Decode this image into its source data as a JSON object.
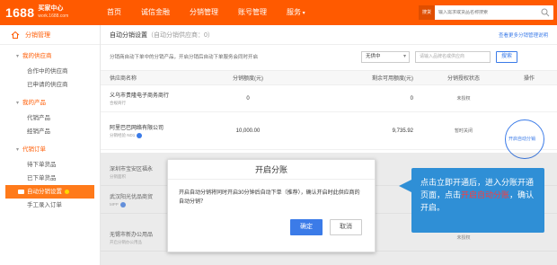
{
  "topbar": {
    "logo_num": "1688",
    "logo_title": "买家中心",
    "logo_url": "work.1688.com",
    "nav": [
      "首页",
      "诚信金融",
      "分销管理",
      "账号管理",
      "服务"
    ],
    "search_type": "搜货",
    "search_placeholder": "输入需求或货品名称搜索",
    "brand_color": "#ff5a00"
  },
  "sidebar": {
    "head": "分销管理",
    "groups": [
      {
        "title": "我的供应商",
        "items": [
          "合作中的供应商",
          "已申请的供应商"
        ]
      },
      {
        "title": "我的产品",
        "items": [
          "代销产品",
          "经销产品"
        ]
      },
      {
        "title": "代销订单",
        "items": [
          "待下单货品",
          "已下单货品",
          "自动分销设置",
          "手工录入订单"
        ]
      }
    ],
    "active_item": "自动分销设置"
  },
  "main": {
    "title": "自动分销设置",
    "title_count": "（自动分销供应商：0）",
    "help_link": "查看更多分销管理说明",
    "desc": "分销商自动下单中的分销产品，开启分销后自动下单服务会同时开启",
    "select_value": "无供中",
    "filter_placeholder": "请输入品牌名或供应商",
    "search_btn": "搜索",
    "columns": [
      "供应商名称",
      "分销额度(元)",
      "剩余可用额度(元)",
      "分销授权状态",
      "操作"
    ],
    "rows": [
      {
        "name": "义乌市贵隆电子商务商行",
        "tag": "合规商行",
        "quota": "0",
        "remain": "0",
        "status": "未授权",
        "action": ""
      },
      {
        "name": "阿里巴巴网络有限公司",
        "tag": "分销经验 ND1",
        "quota": "10,000.00",
        "remain": "9,735.92",
        "status": "暂时关闭",
        "action": "开启自动分销"
      },
      {
        "name": "深圳市宝安区福永",
        "tag": "分销面积",
        "quota": "",
        "remain": "",
        "status": "",
        "action": ""
      },
      {
        "name": "武汉阳光优品商贸",
        "tag": "MPP",
        "quota": "",
        "remain": "",
        "status": "",
        "action": ""
      },
      {
        "name": "无锡市新办公用品",
        "tag": "开启分销办公用品",
        "quota": "",
        "remain": "",
        "status": "未授权",
        "action": ""
      }
    ]
  },
  "modal": {
    "title": "开启分账",
    "body": "开启自动分销将同时开启30分钟后自动下单（推荐），确认开启时此供应商的自动分销？",
    "ok": "确定",
    "cancel": "取消"
  },
  "callout": {
    "part1": "点击立即开通后，进入分账开通页面，点击",
    "highlight": "开启自动分账",
    "part2": "，确认开启。",
    "color": "#2f8fd6"
  }
}
